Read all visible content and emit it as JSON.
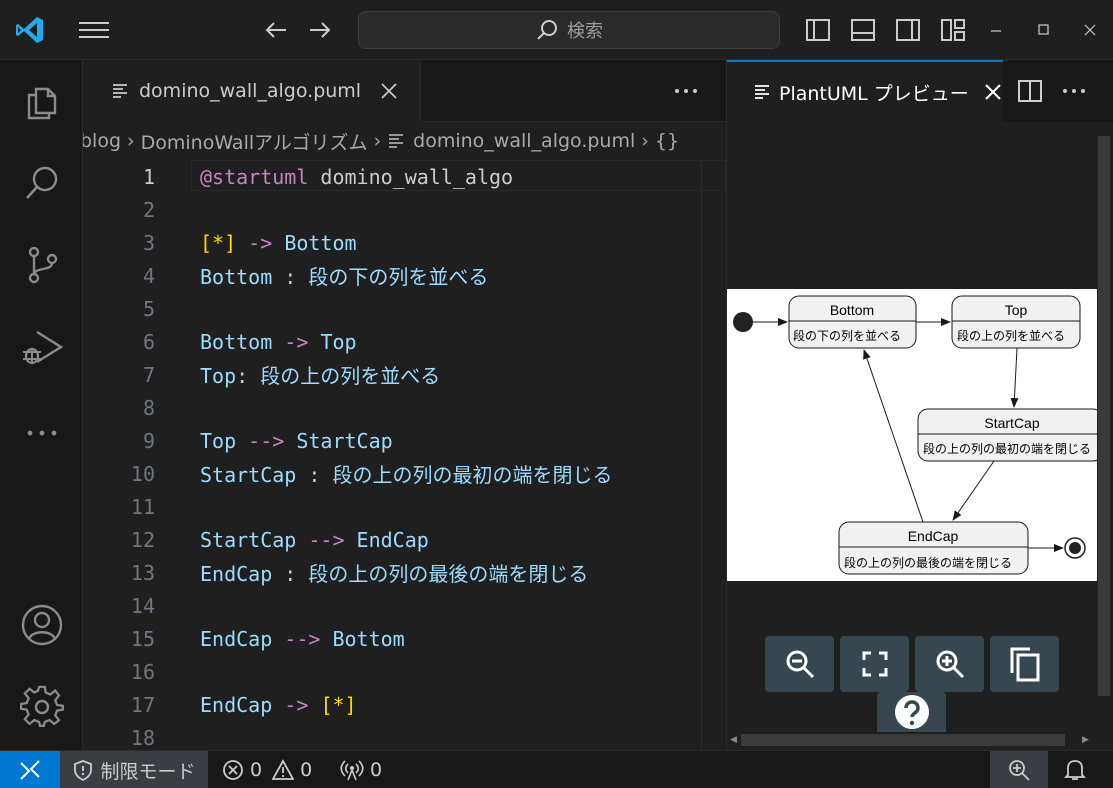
{
  "titlebar": {
    "search_placeholder": "検索"
  },
  "editor": {
    "tab_label": "domino_wall_algo.puml",
    "breadcrumb": [
      "blog",
      "DominoWallアルゴリズム",
      "domino_wall_algo.puml",
      "{}"
    ],
    "lines": [
      {
        "n": "1"
      },
      {
        "n": "2"
      },
      {
        "n": "3"
      },
      {
        "n": "4"
      },
      {
        "n": "5"
      },
      {
        "n": "6"
      },
      {
        "n": "7"
      },
      {
        "n": "8"
      },
      {
        "n": "9"
      },
      {
        "n": "10"
      },
      {
        "n": "11"
      },
      {
        "n": "12"
      },
      {
        "n": "13"
      },
      {
        "n": "14"
      },
      {
        "n": "15"
      },
      {
        "n": "16"
      },
      {
        "n": "17"
      },
      {
        "n": "18"
      }
    ],
    "code": {
      "l1_kw": "@startuml",
      "l1_rest": " domino_wall_algo",
      "l3_start": "[*]",
      "l3_arrow": "->",
      "l3_target": "Bottom",
      "l4_state": "Bottom",
      "l4_colon": " : ",
      "l4_desc": "段の下の列を並べる",
      "l6_from": "Bottom",
      "l6_arrow": "->",
      "l6_to": "Top",
      "l7_state": "Top",
      "l7_colon": ": ",
      "l7_desc": "段の上の列を並べる",
      "l9_from": "Top",
      "l9_arrow": "-->",
      "l9_to": "StartCap",
      "l10_state": "StartCap",
      "l10_colon": " : ",
      "l10_desc": "段の上の列の最初の端を閉じる",
      "l12_from": "StartCap",
      "l12_arrow": "-->",
      "l12_to": "EndCap",
      "l13_state": "EndCap",
      "l13_colon": " : ",
      "l13_desc": "段の上の列の最後の端を閉じる",
      "l15_from": "EndCap",
      "l15_arrow": "-->",
      "l15_to": "Bottom",
      "l17_from": "EndCap",
      "l17_arrow": "->",
      "l17_end": "[*]"
    }
  },
  "preview": {
    "tab_label": "PlantUML プレビュー",
    "states": {
      "bottom_name": "Bottom",
      "bottom_desc": "段の下の列を並べる",
      "top_name": "Top",
      "top_desc": "段の上の列を並べる",
      "startcap_name": "StartCap",
      "startcap_desc": "段の上の列の最初の端を閉じる",
      "endcap_name": "EndCap",
      "endcap_desc": "段の上の列の最後の端を閉じる"
    }
  },
  "statusbar": {
    "restricted_mode": "制限モード",
    "errors": "0",
    "warnings": "0",
    "ports": "0"
  },
  "colors": {
    "accent": "#0078d4",
    "keyword": "#c586c0",
    "identifier": "#9cdcfe",
    "bracket": "#ffd700"
  }
}
